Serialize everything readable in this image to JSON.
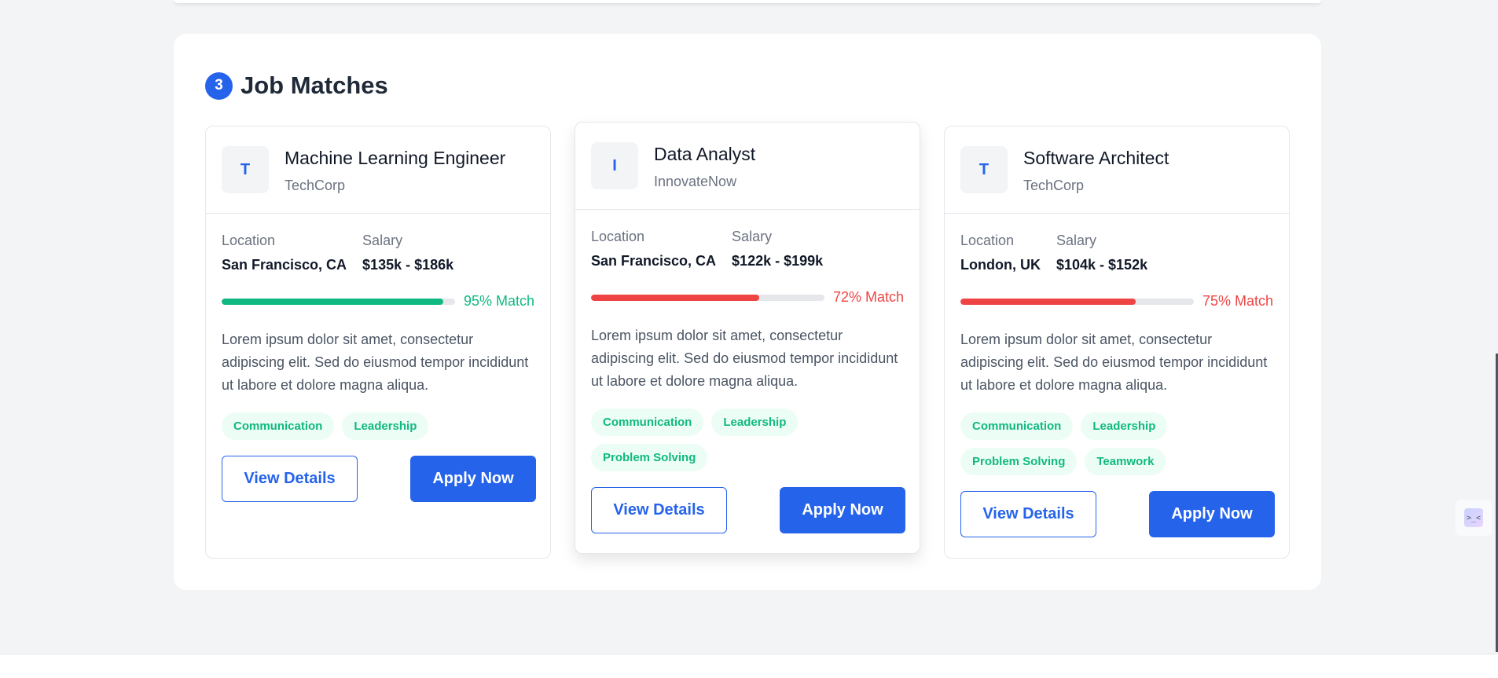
{
  "section": {
    "count": "3",
    "title": "Job Matches"
  },
  "labels": {
    "location": "Location",
    "salary": "Salary",
    "view_details": "View Details",
    "apply_now": "Apply Now"
  },
  "colors": {
    "primary": "#2563eb",
    "match_high": "#10b981",
    "match_low": "#ef4444"
  },
  "jobs": [
    {
      "logo_letter": "T",
      "title": "Machine Learning Engineer",
      "company": "TechCorp",
      "location": "San Francisco, CA",
      "salary": "$135k - $186k",
      "match_percent": 95,
      "match_text": "95% Match",
      "description": "Lorem ipsum dolor sit amet, consectetur adipiscing elit. Sed do eiusmod tempor incididunt ut labore et dolore magna aliqua.",
      "skills": [
        "Communication",
        "Leadership"
      ]
    },
    {
      "logo_letter": "I",
      "title": "Data Analyst",
      "company": "InnovateNow",
      "location": "San Francisco, CA",
      "salary": "$122k - $199k",
      "match_percent": 72,
      "match_text": "72% Match",
      "description": "Lorem ipsum dolor sit amet, consectetur adipiscing elit. Sed do eiusmod tempor incididunt ut labore et dolore magna aliqua.",
      "skills": [
        "Communication",
        "Leadership",
        "Problem Solving"
      ]
    },
    {
      "logo_letter": "T",
      "title": "Software Architect",
      "company": "TechCorp",
      "location": "London, UK",
      "salary": "$104k - $152k",
      "match_percent": 75,
      "match_text": "75% Match",
      "description": "Lorem ipsum dolor sit amet, consectetur adipiscing elit. Sed do eiusmod tempor incididunt ut labore et dolore magna aliqua.",
      "skills": [
        "Communication",
        "Leadership",
        "Problem Solving",
        "Teamwork"
      ]
    }
  ],
  "widget": {
    "icon": "code-icon",
    "glyph": ">_<"
  }
}
